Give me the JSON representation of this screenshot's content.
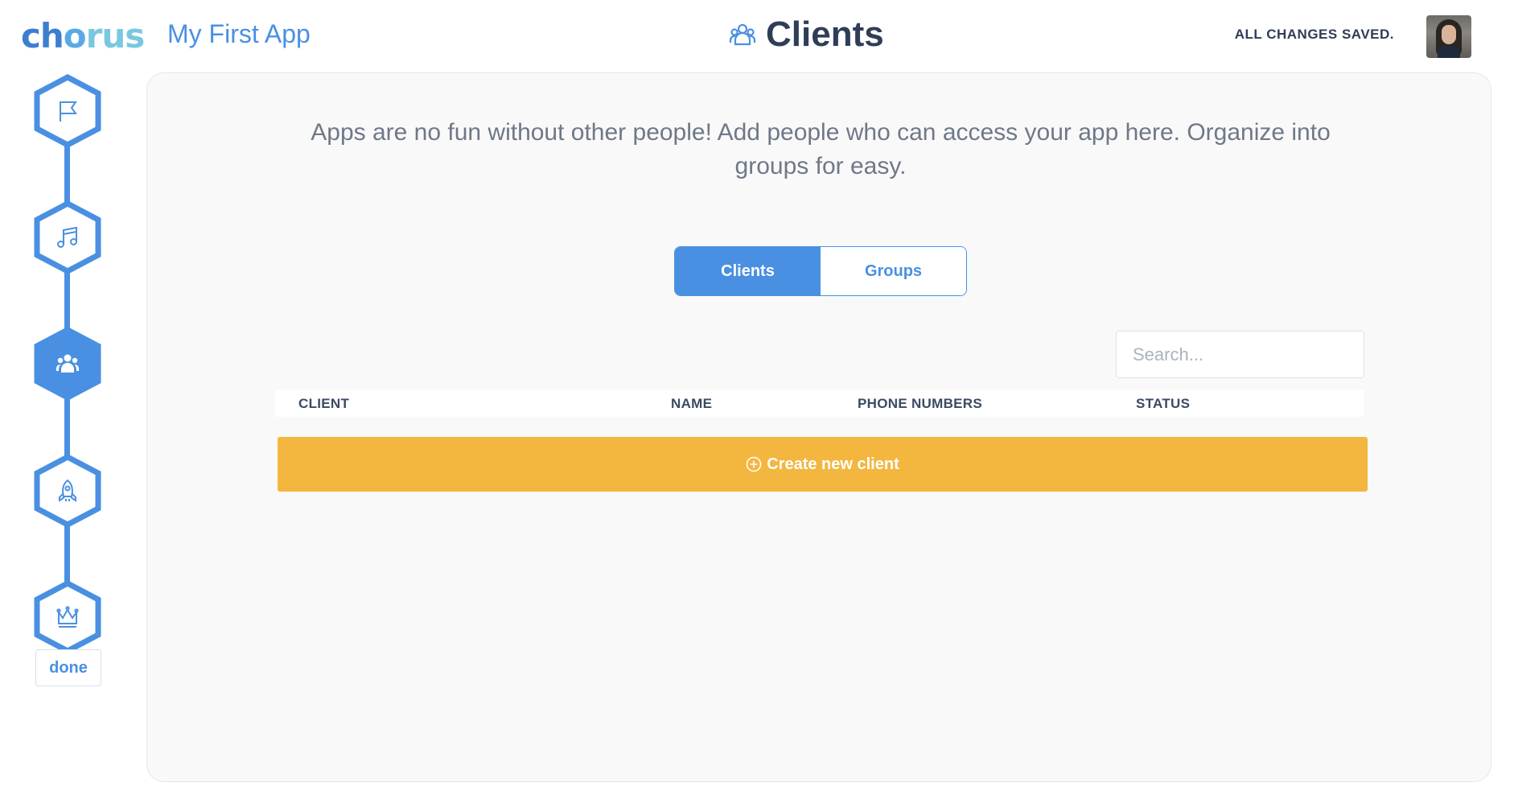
{
  "header": {
    "logo": {
      "part1": "ch",
      "part2": "o",
      "part3": "rus"
    },
    "app_name": "My First App",
    "page_title": "Clients",
    "save_status": "ALL CHANGES SAVED."
  },
  "sidebar": {
    "steps": [
      {
        "icon": "flag-icon",
        "active": false
      },
      {
        "icon": "music-note-icon",
        "active": false
      },
      {
        "icon": "people-icon",
        "active": true
      },
      {
        "icon": "rocket-icon",
        "active": false
      },
      {
        "icon": "crown-icon",
        "active": false
      }
    ],
    "done_label": "done"
  },
  "main": {
    "intro": "Apps are no fun without other people! Add people who can access your app here. Organize into groups for easy.",
    "tabs": [
      {
        "label": "Clients",
        "active": true
      },
      {
        "label": "Groups",
        "active": false
      }
    ],
    "search": {
      "placeholder": "Search...",
      "value": ""
    },
    "table": {
      "columns": [
        "CLIENT",
        "NAME",
        "PHONE NUMBERS",
        "STATUS"
      ],
      "rows": []
    },
    "create_button_label": "Create new client"
  },
  "colors": {
    "accent": "#4a90e2",
    "create_button": "#f3b63f",
    "title": "#2f3d57",
    "panel_bg": "#f9f9f9"
  }
}
